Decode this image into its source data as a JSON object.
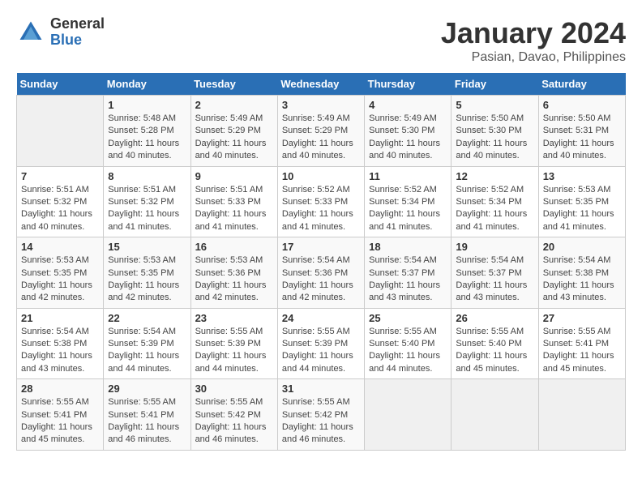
{
  "logo": {
    "general": "General",
    "blue": "Blue"
  },
  "title": "January 2024",
  "subtitle": "Pasian, Davao, Philippines",
  "weekdays": [
    "Sunday",
    "Monday",
    "Tuesday",
    "Wednesday",
    "Thursday",
    "Friday",
    "Saturday"
  ],
  "weeks": [
    [
      {
        "day": "",
        "sunrise": "",
        "sunset": "",
        "daylight": ""
      },
      {
        "day": "1",
        "sunrise": "Sunrise: 5:48 AM",
        "sunset": "Sunset: 5:28 PM",
        "daylight": "Daylight: 11 hours and 40 minutes."
      },
      {
        "day": "2",
        "sunrise": "Sunrise: 5:49 AM",
        "sunset": "Sunset: 5:29 PM",
        "daylight": "Daylight: 11 hours and 40 minutes."
      },
      {
        "day": "3",
        "sunrise": "Sunrise: 5:49 AM",
        "sunset": "Sunset: 5:29 PM",
        "daylight": "Daylight: 11 hours and 40 minutes."
      },
      {
        "day": "4",
        "sunrise": "Sunrise: 5:49 AM",
        "sunset": "Sunset: 5:30 PM",
        "daylight": "Daylight: 11 hours and 40 minutes."
      },
      {
        "day": "5",
        "sunrise": "Sunrise: 5:50 AM",
        "sunset": "Sunset: 5:30 PM",
        "daylight": "Daylight: 11 hours and 40 minutes."
      },
      {
        "day": "6",
        "sunrise": "Sunrise: 5:50 AM",
        "sunset": "Sunset: 5:31 PM",
        "daylight": "Daylight: 11 hours and 40 minutes."
      }
    ],
    [
      {
        "day": "7",
        "sunrise": "Sunrise: 5:51 AM",
        "sunset": "Sunset: 5:32 PM",
        "daylight": "Daylight: 11 hours and 40 minutes."
      },
      {
        "day": "8",
        "sunrise": "Sunrise: 5:51 AM",
        "sunset": "Sunset: 5:32 PM",
        "daylight": "Daylight: 11 hours and 41 minutes."
      },
      {
        "day": "9",
        "sunrise": "Sunrise: 5:51 AM",
        "sunset": "Sunset: 5:33 PM",
        "daylight": "Daylight: 11 hours and 41 minutes."
      },
      {
        "day": "10",
        "sunrise": "Sunrise: 5:52 AM",
        "sunset": "Sunset: 5:33 PM",
        "daylight": "Daylight: 11 hours and 41 minutes."
      },
      {
        "day": "11",
        "sunrise": "Sunrise: 5:52 AM",
        "sunset": "Sunset: 5:34 PM",
        "daylight": "Daylight: 11 hours and 41 minutes."
      },
      {
        "day": "12",
        "sunrise": "Sunrise: 5:52 AM",
        "sunset": "Sunset: 5:34 PM",
        "daylight": "Daylight: 11 hours and 41 minutes."
      },
      {
        "day": "13",
        "sunrise": "Sunrise: 5:53 AM",
        "sunset": "Sunset: 5:35 PM",
        "daylight": "Daylight: 11 hours and 41 minutes."
      }
    ],
    [
      {
        "day": "14",
        "sunrise": "Sunrise: 5:53 AM",
        "sunset": "Sunset: 5:35 PM",
        "daylight": "Daylight: 11 hours and 42 minutes."
      },
      {
        "day": "15",
        "sunrise": "Sunrise: 5:53 AM",
        "sunset": "Sunset: 5:35 PM",
        "daylight": "Daylight: 11 hours and 42 minutes."
      },
      {
        "day": "16",
        "sunrise": "Sunrise: 5:53 AM",
        "sunset": "Sunset: 5:36 PM",
        "daylight": "Daylight: 11 hours and 42 minutes."
      },
      {
        "day": "17",
        "sunrise": "Sunrise: 5:54 AM",
        "sunset": "Sunset: 5:36 PM",
        "daylight": "Daylight: 11 hours and 42 minutes."
      },
      {
        "day": "18",
        "sunrise": "Sunrise: 5:54 AM",
        "sunset": "Sunset: 5:37 PM",
        "daylight": "Daylight: 11 hours and 43 minutes."
      },
      {
        "day": "19",
        "sunrise": "Sunrise: 5:54 AM",
        "sunset": "Sunset: 5:37 PM",
        "daylight": "Daylight: 11 hours and 43 minutes."
      },
      {
        "day": "20",
        "sunrise": "Sunrise: 5:54 AM",
        "sunset": "Sunset: 5:38 PM",
        "daylight": "Daylight: 11 hours and 43 minutes."
      }
    ],
    [
      {
        "day": "21",
        "sunrise": "Sunrise: 5:54 AM",
        "sunset": "Sunset: 5:38 PM",
        "daylight": "Daylight: 11 hours and 43 minutes."
      },
      {
        "day": "22",
        "sunrise": "Sunrise: 5:54 AM",
        "sunset": "Sunset: 5:39 PM",
        "daylight": "Daylight: 11 hours and 44 minutes."
      },
      {
        "day": "23",
        "sunrise": "Sunrise: 5:55 AM",
        "sunset": "Sunset: 5:39 PM",
        "daylight": "Daylight: 11 hours and 44 minutes."
      },
      {
        "day": "24",
        "sunrise": "Sunrise: 5:55 AM",
        "sunset": "Sunset: 5:39 PM",
        "daylight": "Daylight: 11 hours and 44 minutes."
      },
      {
        "day": "25",
        "sunrise": "Sunrise: 5:55 AM",
        "sunset": "Sunset: 5:40 PM",
        "daylight": "Daylight: 11 hours and 44 minutes."
      },
      {
        "day": "26",
        "sunrise": "Sunrise: 5:55 AM",
        "sunset": "Sunset: 5:40 PM",
        "daylight": "Daylight: 11 hours and 45 minutes."
      },
      {
        "day": "27",
        "sunrise": "Sunrise: 5:55 AM",
        "sunset": "Sunset: 5:41 PM",
        "daylight": "Daylight: 11 hours and 45 minutes."
      }
    ],
    [
      {
        "day": "28",
        "sunrise": "Sunrise: 5:55 AM",
        "sunset": "Sunset: 5:41 PM",
        "daylight": "Daylight: 11 hours and 45 minutes."
      },
      {
        "day": "29",
        "sunrise": "Sunrise: 5:55 AM",
        "sunset": "Sunset: 5:41 PM",
        "daylight": "Daylight: 11 hours and 46 minutes."
      },
      {
        "day": "30",
        "sunrise": "Sunrise: 5:55 AM",
        "sunset": "Sunset: 5:42 PM",
        "daylight": "Daylight: 11 hours and 46 minutes."
      },
      {
        "day": "31",
        "sunrise": "Sunrise: 5:55 AM",
        "sunset": "Sunset: 5:42 PM",
        "daylight": "Daylight: 11 hours and 46 minutes."
      },
      {
        "day": "",
        "sunrise": "",
        "sunset": "",
        "daylight": ""
      },
      {
        "day": "",
        "sunrise": "",
        "sunset": "",
        "daylight": ""
      },
      {
        "day": "",
        "sunrise": "",
        "sunset": "",
        "daylight": ""
      }
    ]
  ]
}
